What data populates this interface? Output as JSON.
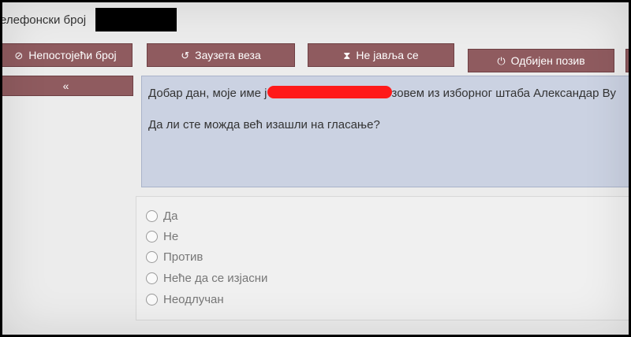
{
  "header": {
    "phone_label": "елефонски број"
  },
  "toolbar": {
    "buttons": [
      {
        "label": "Непостојећи број",
        "icon": "⊘"
      },
      {
        "label": "Заузета веза",
        "icon": "↺"
      },
      {
        "label": "Не јавља се",
        "icon": "⧗"
      },
      {
        "label": "Одбијен позив",
        "icon": "⏻"
      }
    ],
    "back_icon": "«",
    "accent": "#8f5b5f"
  },
  "script": {
    "line1_start": "Добар дан, моје име ј",
    "line1_end": "зовем из изборног штаба Александар Ву",
    "line2": "Да ли сте можда већ изашли на гласање?",
    "box_color": "#cbd2e2"
  },
  "answers": [
    {
      "label": "Да"
    },
    {
      "label": "Не"
    },
    {
      "label": "Против"
    },
    {
      "label": "Неће да се изјасни"
    },
    {
      "label": "Неодлучан"
    }
  ]
}
